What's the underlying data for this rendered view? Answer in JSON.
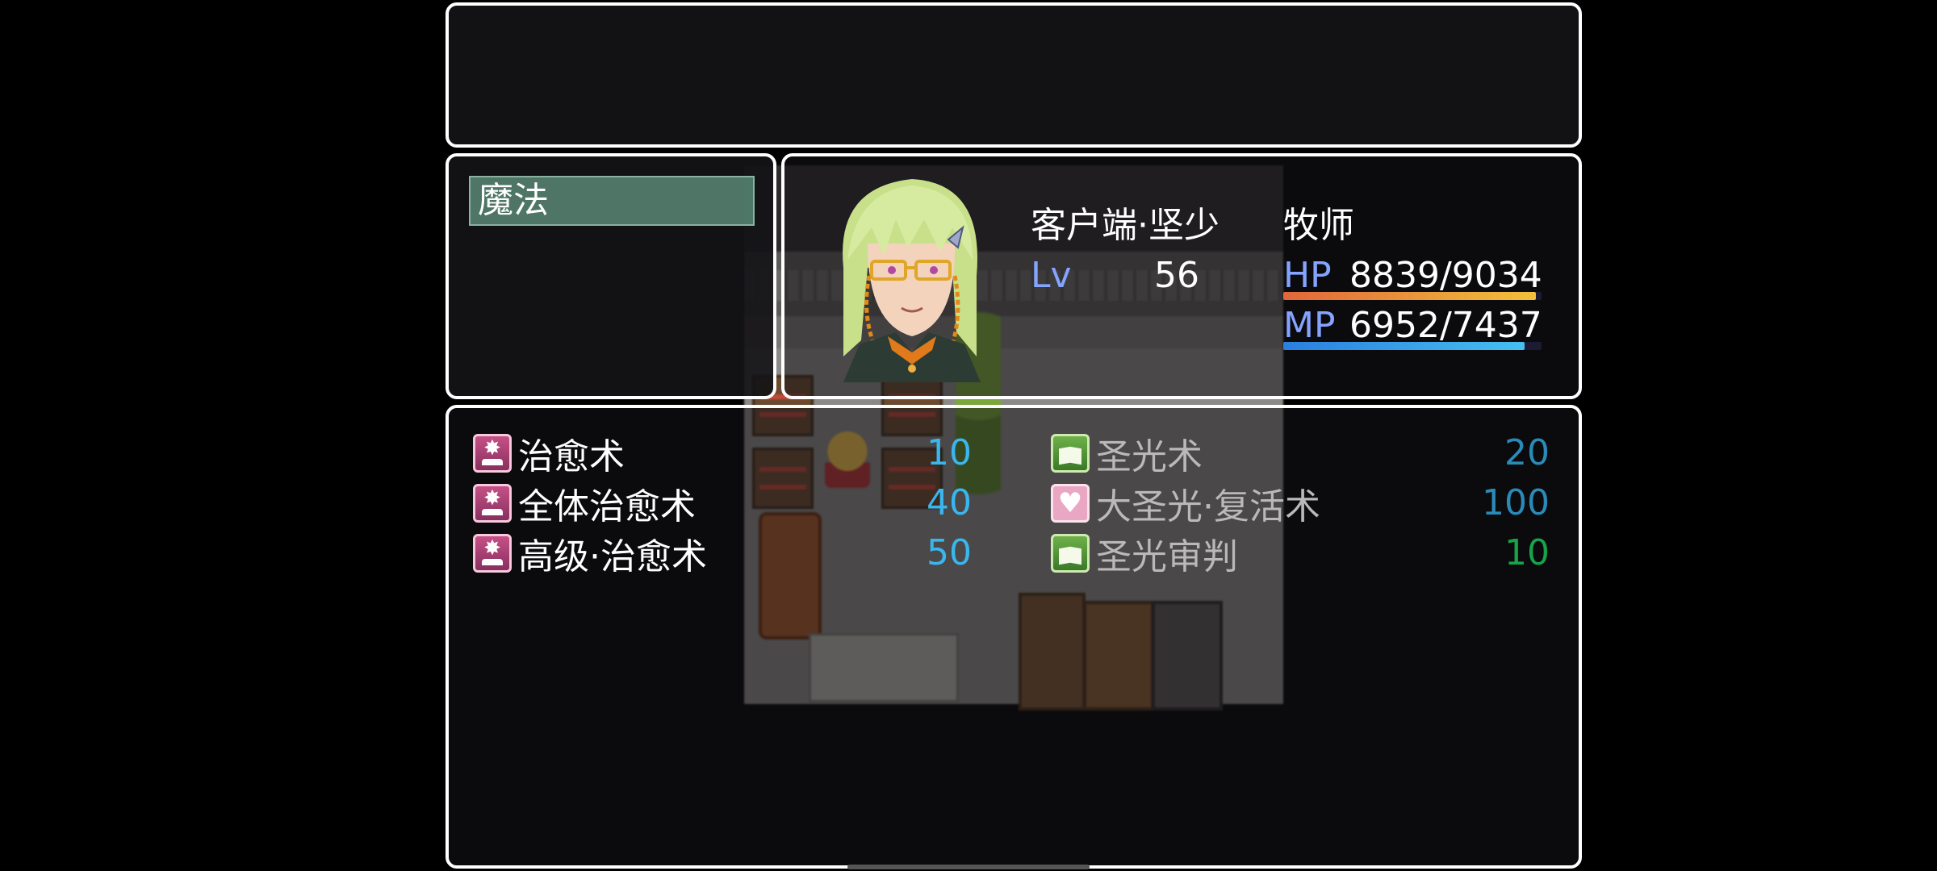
{
  "help_window": {
    "text": ""
  },
  "skill_type_window": {
    "items": [
      {
        "label": "魔法",
        "selected": true
      }
    ]
  },
  "actor": {
    "name": "客户端·坚少",
    "class": "牧师",
    "level_label": "Lv",
    "level": "56",
    "hp_label": "HP",
    "hp_value": "8839/9034",
    "hp_fraction": 0.978,
    "mp_label": "MP",
    "mp_value": "6952/7437",
    "mp_fraction": 0.935,
    "face_icon": "green-haired-priest-portrait"
  },
  "skills": [
    {
      "name": "治愈术",
      "cost": "10",
      "icon": "heal-icon",
      "cost_type": "mp",
      "enabled": true
    },
    {
      "name": "圣光术",
      "cost": "20",
      "icon": "book-icon",
      "cost_type": "mp",
      "enabled": false
    },
    {
      "name": "全体治愈术",
      "cost": "40",
      "icon": "heal-icon",
      "cost_type": "mp",
      "enabled": true
    },
    {
      "name": "大圣光·复活术",
      "cost": "100",
      "icon": "heart-icon",
      "cost_type": "mp",
      "enabled": false
    },
    {
      "name": "高级·治愈术",
      "cost": "50",
      "icon": "heal-icon",
      "cost_type": "mp",
      "enabled": true
    },
    {
      "name": "圣光审判",
      "cost": "10",
      "icon": "book-icon",
      "cost_type": "tp",
      "enabled": false
    }
  ],
  "colors": {
    "hp_gauge": [
      "#e0673a",
      "#f2c13a"
    ],
    "mp_gauge": [
      "#2a7fe0",
      "#46c0f0"
    ],
    "mp_cost": "#3ab6ee",
    "tp_cost": "#17a34a",
    "system_text": "#84a4ff",
    "selection": "#80c8aa"
  }
}
